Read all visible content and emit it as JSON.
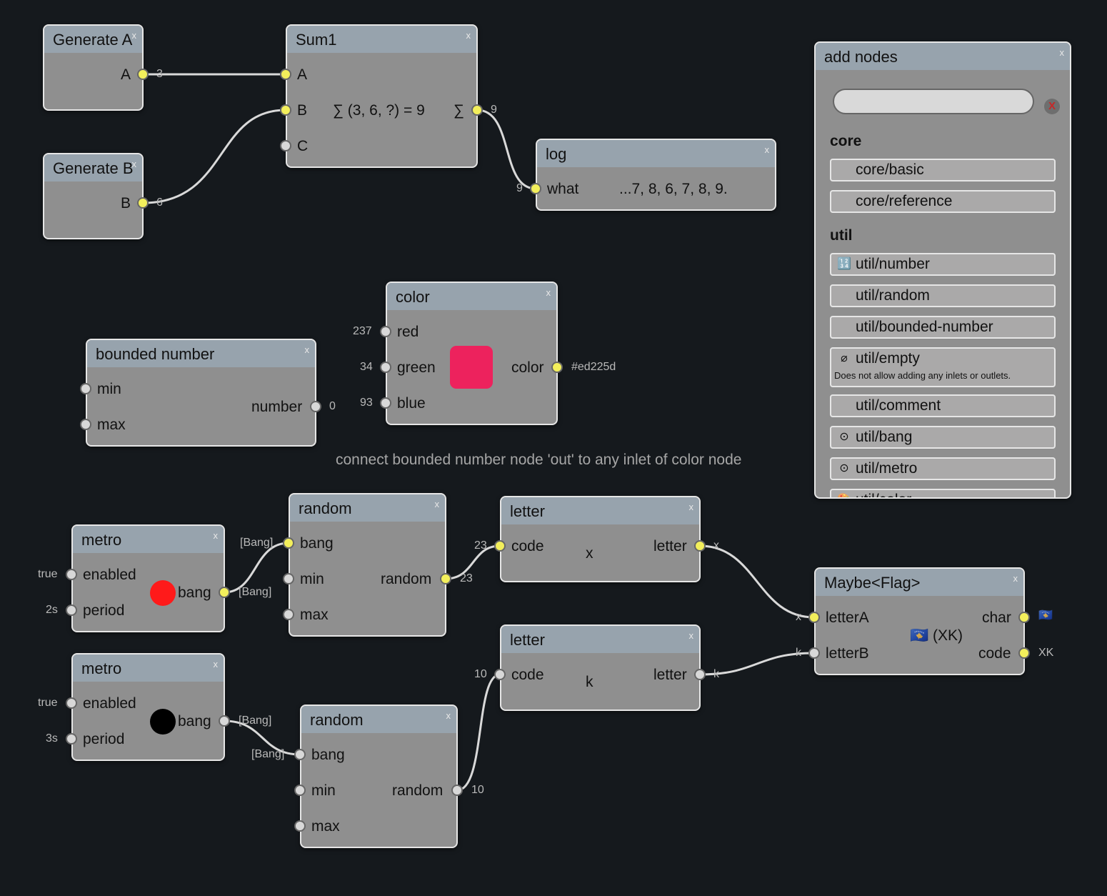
{
  "nodes": {
    "generate_a": {
      "title": "Generate A",
      "out_label": "A",
      "out_value": "3"
    },
    "generate_b": {
      "title": "Generate B",
      "out_label": "B",
      "out_value": "6"
    },
    "sum": {
      "title": "Sum1",
      "inputs": [
        "A",
        "B",
        "C"
      ],
      "expression": "∑ (3, 6, ?) = 9",
      "out_label": "∑",
      "out_value": "9"
    },
    "log": {
      "title": "log",
      "in_label": "what",
      "in_value": "9",
      "content": "...7, 8, 6, 7, 8, 9."
    },
    "color": {
      "title": "color",
      "inputs": [
        {
          "label": "red",
          "value": "237"
        },
        {
          "label": "green",
          "value": "34"
        },
        {
          "label": "blue",
          "value": "93"
        }
      ],
      "swatch": "#ed225d",
      "out_label": "color",
      "out_value": "#ed225d"
    },
    "bounded": {
      "title": "bounded number",
      "inputs": [
        "min",
        "max"
      ],
      "out_label": "number",
      "out_value": "0"
    },
    "metro1": {
      "title": "metro",
      "inputs": [
        {
          "label": "enabled",
          "value": "true"
        },
        {
          "label": "period",
          "value": "2s"
        }
      ],
      "indicator": "#ff1a1a",
      "out_label": "bang",
      "out_value": "[Bang]"
    },
    "metro2": {
      "title": "metro",
      "inputs": [
        {
          "label": "enabled",
          "value": "true"
        },
        {
          "label": "period",
          "value": "3s"
        }
      ],
      "indicator": "#000000",
      "out_label": "bang",
      "out_value": "[Bang]"
    },
    "random1": {
      "title": "random",
      "inputs": [
        "bang",
        "min",
        "max"
      ],
      "in_value": "[Bang]",
      "out_label": "random",
      "out_value": "23"
    },
    "random2": {
      "title": "random",
      "inputs": [
        "bang",
        "min",
        "max"
      ],
      "in_value": "[Bang]",
      "out_label": "random",
      "out_value": "10"
    },
    "letter1": {
      "title": "letter",
      "in_label": "code",
      "in_value": "23",
      "content": "x",
      "out_label": "letter",
      "out_value": "x"
    },
    "letter2": {
      "title": "letter",
      "in_label": "code",
      "in_value": "10",
      "content": "k",
      "out_label": "letter",
      "out_value": "k"
    },
    "maybe": {
      "title": "Maybe<Flag>",
      "inputs": [
        {
          "label": "letterA",
          "value": "x"
        },
        {
          "label": "letterB",
          "value": "k"
        }
      ],
      "content": "🇽🇰 (XK)",
      "outputs": [
        {
          "label": "char",
          "value": "🇽🇰"
        },
        {
          "label": "code",
          "value": "XK"
        }
      ]
    }
  },
  "hint": "connect bounded number node 'out' to any inlet of color node",
  "close_glyph": "x",
  "palette": {
    "title": "add nodes",
    "clear_label": "X",
    "search_value": "",
    "categories": [
      {
        "name": "core",
        "items": [
          {
            "icon": "",
            "label": "core/basic"
          },
          {
            "icon": "",
            "label": "core/reference"
          }
        ]
      },
      {
        "name": "util",
        "items": [
          {
            "icon": "🔢",
            "label": "util/number"
          },
          {
            "icon": "",
            "label": "util/random"
          },
          {
            "icon": "",
            "label": "util/bounded-number"
          },
          {
            "icon": "⌀",
            "label": "util/empty",
            "description": "Does not allow adding any inlets or outlets."
          },
          {
            "icon": "",
            "label": "util/comment"
          },
          {
            "icon": "⊙",
            "label": "util/bang"
          },
          {
            "icon": "⊙",
            "label": "util/metro"
          },
          {
            "icon": "🎨",
            "label": "util/color"
          }
        ]
      }
    ]
  },
  "colors": {
    "wire": "#d9d9d9",
    "port_active": "#f3ef5b",
    "port_idle": "#d8d8d8",
    "node_bg": "#8f8f8f",
    "title_bg": "#97a3ad",
    "canvas_bg": "#15191d"
  }
}
